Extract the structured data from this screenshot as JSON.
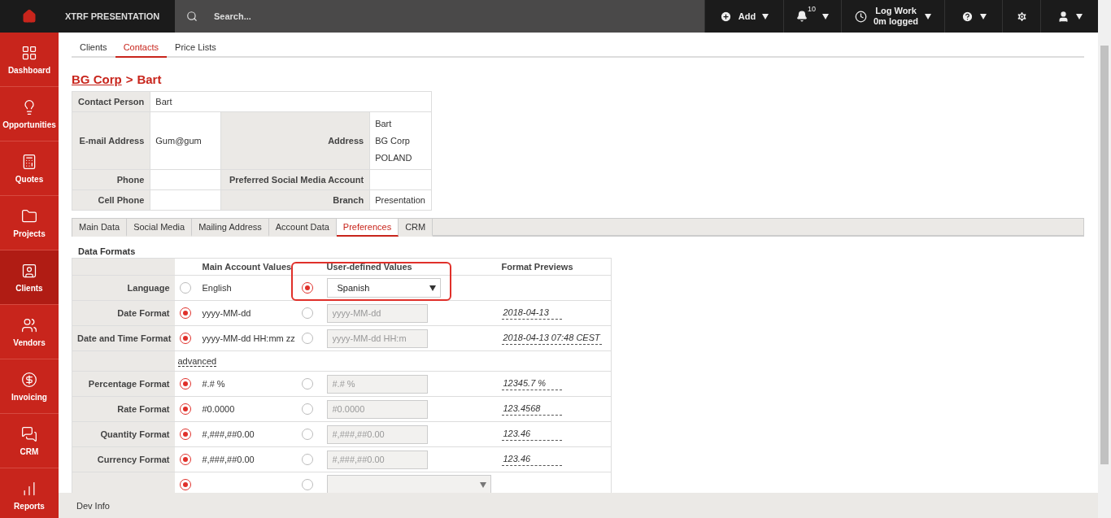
{
  "topbar": {
    "brand": "XTRF PRESENTATION",
    "search": {
      "placeholder": "Search..."
    },
    "add": "Add",
    "notification_count": "10",
    "log_work": {
      "title": "Log Work",
      "subtitle": "0m logged"
    }
  },
  "sidebar": {
    "items": [
      {
        "label": "Dashboard",
        "selected": false
      },
      {
        "label": "Opportunities",
        "selected": false
      },
      {
        "label": "Quotes",
        "selected": false
      },
      {
        "label": "Projects",
        "selected": false
      },
      {
        "label": "Clients",
        "selected": true
      },
      {
        "label": "Vendors",
        "selected": false
      },
      {
        "label": "Invoicing",
        "selected": false
      },
      {
        "label": "CRM",
        "selected": false
      },
      {
        "label": "Reports",
        "selected": false
      }
    ]
  },
  "tabs": [
    {
      "label": "Clients",
      "selected": false
    },
    {
      "label": "Contacts",
      "selected": true
    },
    {
      "label": "Price Lists",
      "selected": false
    }
  ],
  "breadcrumb": {
    "parent": "BG Corp",
    "separator": ">",
    "current": "Bart"
  },
  "contact": {
    "contact_person": {
      "label": "Contact Person",
      "value": "Bart"
    },
    "email": {
      "label": "E-mail Address",
      "value": "Gum@gum"
    },
    "address": {
      "label": "Address",
      "lines": [
        "Bart",
        "BG Corp",
        "POLAND"
      ]
    },
    "phone": {
      "label": "Phone"
    },
    "social": {
      "label": "Preferred Social Media Account"
    },
    "cell_phone": {
      "label": "Cell Phone"
    },
    "branch": {
      "label": "Branch",
      "value": "Presentation"
    }
  },
  "section_tabs": [
    {
      "label": "Main Data",
      "selected": false
    },
    {
      "label": "Social Media",
      "selected": false
    },
    {
      "label": "Mailing Address",
      "selected": false
    },
    {
      "label": "Account Data",
      "selected": false
    },
    {
      "label": "Preferences",
      "selected": true
    },
    {
      "label": "CRM",
      "selected": false
    }
  ],
  "data_formats": {
    "title": "Data Formats",
    "columns": [
      "Main Account Values",
      "User-defined Values",
      "Format Previews"
    ],
    "rows": [
      {
        "kind": "select",
        "label": "Language",
        "main_selected": false,
        "main_value": "English",
        "user_selected": true,
        "user_value": "Spanish"
      },
      {
        "kind": "input",
        "label": "Date Format",
        "main_selected": true,
        "main_value": "yyyy-MM-dd",
        "user_selected": false,
        "user_value": "yyyy-MM-dd",
        "preview": "2018-04-13"
      },
      {
        "kind": "input",
        "label": "Date and Time Format",
        "main_selected": true,
        "main_value": "yyyy-MM-dd HH:mm zz",
        "user_selected": false,
        "user_value": "yyyy-MM-dd HH:m",
        "preview": "2018-04-13 07:48 CEST"
      },
      {
        "kind": "link",
        "link": "advanced"
      },
      {
        "kind": "input",
        "label": "Percentage Format",
        "main_selected": true,
        "main_value": "#.# %",
        "user_selected": false,
        "user_value": "#.# %",
        "preview": "12345.7 %"
      },
      {
        "kind": "input",
        "label": "Rate Format",
        "main_selected": true,
        "main_value": "#0.0000",
        "user_selected": false,
        "user_value": "#0.0000",
        "preview": "123.4568"
      },
      {
        "kind": "input",
        "label": "Quantity Format",
        "main_selected": true,
        "main_value": "#,###,##0.00",
        "user_selected": false,
        "user_value": "#,###,##0.00",
        "preview": "123.46"
      },
      {
        "kind": "input",
        "label": "Currency Format",
        "main_selected": true,
        "main_value": "#,###,##0.00",
        "user_selected": false,
        "user_value": "#,###,##0.00",
        "preview": "123.46"
      },
      {
        "kind": "select",
        "main_selected": true,
        "user_selected": false
      }
    ]
  },
  "footer": {
    "label": "Dev Info"
  }
}
